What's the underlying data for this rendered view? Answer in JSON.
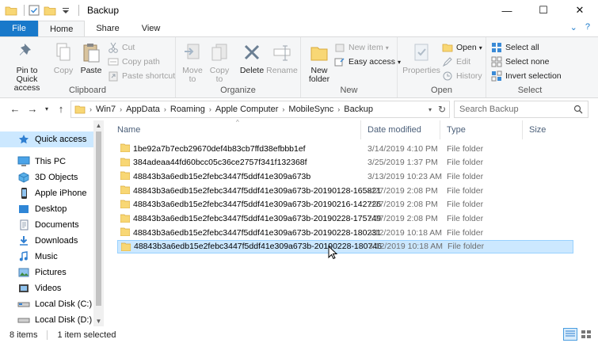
{
  "window": {
    "title": "Backup"
  },
  "ribbon_tabs": [
    "File",
    "Home",
    "Share",
    "View"
  ],
  "clipboard": {
    "pin_label_1": "Pin to Quick",
    "pin_label_2": "access",
    "copy": "Copy",
    "paste": "Paste",
    "cut": "Cut",
    "copy_path": "Copy path",
    "paste_shortcut": "Paste shortcut",
    "group": "Clipboard"
  },
  "organize": {
    "move_1": "Move",
    "move_2": "to",
    "copy_1": "Copy",
    "copy_2": "to",
    "delete": "Delete",
    "rename": "Rename",
    "group": "Organize"
  },
  "new": {
    "new_folder_1": "New",
    "new_folder_2": "folder",
    "new_item": "New item",
    "easy_access": "Easy access",
    "group": "New"
  },
  "open": {
    "properties": "Properties",
    "open": "Open",
    "edit": "Edit",
    "history": "History",
    "group": "Open"
  },
  "select": {
    "select_all": "Select all",
    "select_none": "Select none",
    "invert": "Invert selection",
    "group": "Select"
  },
  "address": {
    "crumbs": [
      "Win7",
      "AppData",
      "Roaming",
      "Apple Computer",
      "MobileSync",
      "Backup"
    ]
  },
  "search": {
    "placeholder": "Search Backup"
  },
  "nav": {
    "quick_access": "Quick access",
    "this_pc": "This PC",
    "objects_3d": "3D Objects",
    "apple_iphone": "Apple iPhone",
    "desktop": "Desktop",
    "documents": "Documents",
    "downloads": "Downloads",
    "music": "Music",
    "pictures": "Pictures",
    "videos": "Videos",
    "local_c": "Local Disk (C:)",
    "local_d": "Local Disk (D:)"
  },
  "columns": {
    "name": "Name",
    "date": "Date modified",
    "type": "Type",
    "size": "Size"
  },
  "files": [
    {
      "name": "1be92a7b7ecb29670def4b83cb7ffd38efbbb1ef",
      "date": "3/14/2019 4:10 PM",
      "type": "File folder"
    },
    {
      "name": "384adeaa44fd60bcc05c36ce2757f341f132368f",
      "date": "3/25/2019 1:37 PM",
      "type": "File folder"
    },
    {
      "name": "48843b3a6edb15e2febc3447f5ddf41e309a673b",
      "date": "3/13/2019 10:23 AM",
      "type": "File folder"
    },
    {
      "name": "48843b3a6edb15e2febc3447f5ddf41e309a673b-20190128-165821",
      "date": "2/27/2019 2:08 PM",
      "type": "File folder"
    },
    {
      "name": "48843b3a6edb15e2febc3447f5ddf41e309a673b-20190216-142726",
      "date": "2/27/2019 2:08 PM",
      "type": "File folder"
    },
    {
      "name": "48843b3a6edb15e2febc3447f5ddf41e309a673b-20190228-175749",
      "date": "2/27/2019 2:08 PM",
      "type": "File folder"
    },
    {
      "name": "48843b3a6edb15e2febc3447f5ddf41e309a673b-20190228-180231",
      "date": "3/12/2019 10:18 AM",
      "type": "File folder"
    },
    {
      "name": "48843b3a6edb15e2febc3447f5ddf41e309a673b-20190228-180746",
      "date": "3/12/2019 10:18 AM",
      "type": "File folder"
    }
  ],
  "status": {
    "count": "8 items",
    "selected": "1 item selected"
  },
  "colors": {
    "accent": "#1979ca",
    "selection": "#cce8ff",
    "folder": "#f8d775"
  }
}
